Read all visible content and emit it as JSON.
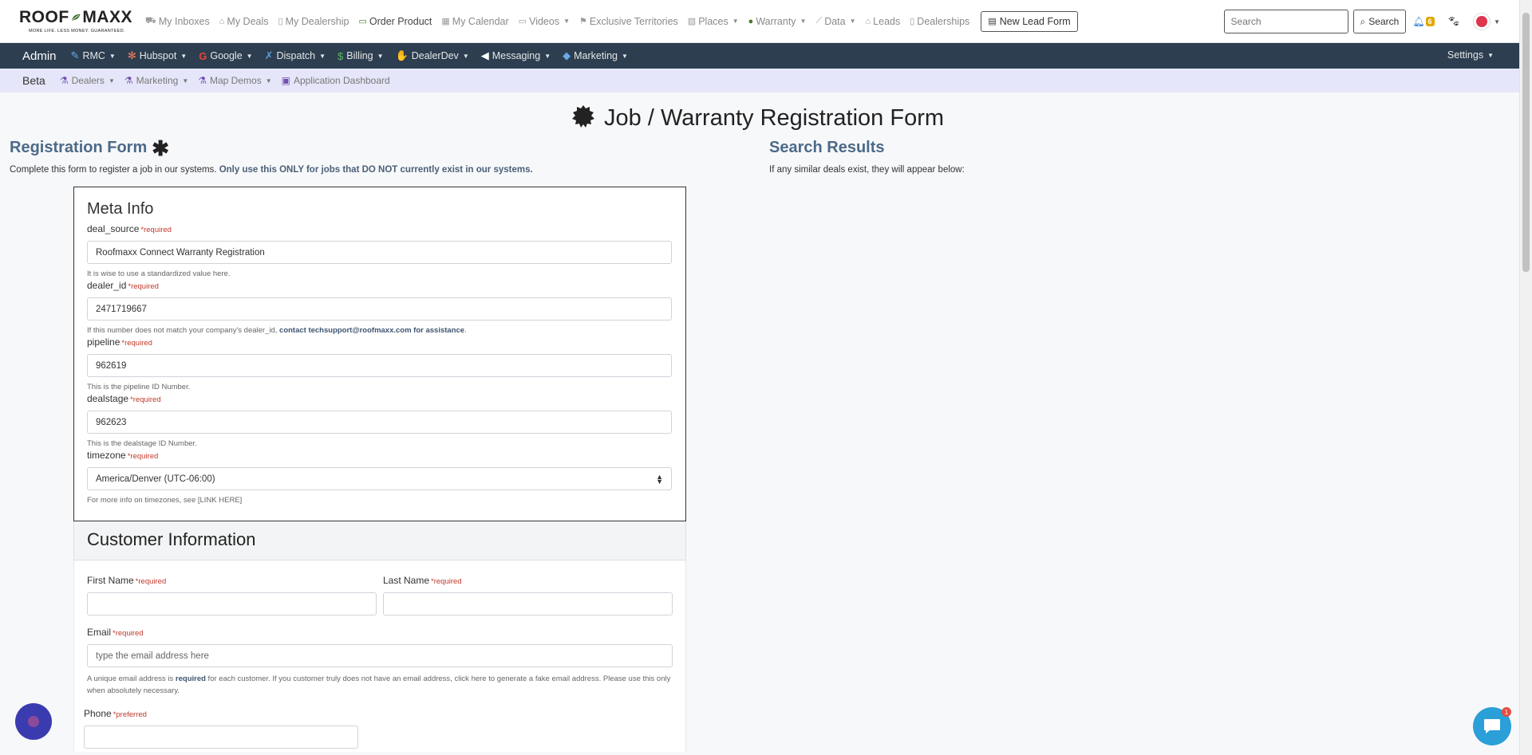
{
  "brand": {
    "name_left": "ROOF",
    "name_right": "MAXX",
    "tagline": "MORE LIFE. LESS MONEY. GUARANTEED."
  },
  "topnav": {
    "items": [
      {
        "label": "My Inboxes",
        "icon": "inbox-icon",
        "glyph": "⛟"
      },
      {
        "label": "My Deals",
        "icon": "home-icon",
        "glyph": "⌂"
      },
      {
        "label": "My Dealership",
        "icon": "building-icon",
        "glyph": "▯"
      },
      {
        "label": "Order Product",
        "icon": "product-icon",
        "glyph": "▭"
      },
      {
        "label": "My Calendar",
        "icon": "calendar-icon",
        "glyph": "▦"
      },
      {
        "label": "Videos",
        "icon": "monitor-icon",
        "glyph": "▭"
      },
      {
        "label": "Exclusive Territories",
        "icon": "flag-icon",
        "glyph": "⚑"
      },
      {
        "label": "Places",
        "icon": "map-icon",
        "glyph": "▧"
      },
      {
        "label": "Warranty",
        "icon": "seal-icon",
        "glyph": "●"
      },
      {
        "label": "Data",
        "icon": "chart-line-icon",
        "glyph": "📈"
      },
      {
        "label": "Leads",
        "icon": "home-icon",
        "glyph": "⌂"
      },
      {
        "label": "Dealerships",
        "icon": "building-icon",
        "glyph": "▯"
      }
    ],
    "new_lead_label": "New Lead Form",
    "search_placeholder": "Search",
    "search_button": "Search",
    "notification_count": "6"
  },
  "adminbar": {
    "title": "Admin",
    "items": [
      {
        "label": "RMC",
        "icon": "feather-icon",
        "glyph": "✎"
      },
      {
        "label": "Hubspot",
        "icon": "hubspot-icon",
        "glyph": "✻"
      },
      {
        "label": "Google",
        "icon": "google-icon",
        "glyph": "G"
      },
      {
        "label": "Dispatch",
        "icon": "wrench-icon",
        "glyph": "✗"
      },
      {
        "label": "Billing",
        "icon": "dollar-icon",
        "glyph": "$"
      },
      {
        "label": "DealerDev",
        "icon": "handshake-icon",
        "glyph": "✋"
      },
      {
        "label": "Messaging",
        "icon": "bullhorn-icon",
        "glyph": "📢"
      },
      {
        "label": "Marketing",
        "icon": "tags-icon",
        "glyph": "🏷"
      }
    ],
    "settings": "Settings"
  },
  "betabar": {
    "title": "Beta",
    "items": [
      {
        "label": "Dealers",
        "icon": "flask-icon",
        "caret": true
      },
      {
        "label": "Marketing",
        "icon": "flask-icon",
        "caret": true
      },
      {
        "label": "Map Demos",
        "icon": "flask-icon",
        "caret": true
      },
      {
        "label": "Application Dashboard",
        "icon": "dashboard-icon",
        "caret": false
      }
    ]
  },
  "page": {
    "title": "Job / Warranty Registration Form"
  },
  "registration": {
    "heading": "Registration Form",
    "desc_plain": "Complete this form to register a job in our systems. ",
    "desc_bold": "Only use this ONLY for jobs that DO NOT currently exist in our systems."
  },
  "search_results": {
    "heading": "Search Results",
    "desc": "If any similar deals exist, they will appear below:"
  },
  "meta": {
    "heading": "Meta Info",
    "required_text": "*required",
    "fields": {
      "deal_source": {
        "label": "deal_source",
        "value": "Roofmaxx Connect Warranty Registration",
        "help": "It is wise to use a standardized value here."
      },
      "dealer_id": {
        "label": "dealer_id",
        "value": "2471719667",
        "help_plain": "If this number does not match your company's dealer_id, ",
        "help_bold": "contact techsupport@roofmaxx.com for assistance",
        "help_end": "."
      },
      "pipeline": {
        "label": "pipeline",
        "value": "962619",
        "help": "This is the pipeline ID Number."
      },
      "dealstage": {
        "label": "dealstage",
        "value": "962623",
        "help": "This is the dealstage ID Number."
      },
      "timezone": {
        "label": "timezone",
        "value": "America/Denver (UTC-06:00)",
        "help": "For more info on timezones, see [LINK HERE]"
      }
    }
  },
  "customer": {
    "heading": "Customer Information",
    "first_name_label": "First Name",
    "last_name_label": "Last Name",
    "email_label": "Email",
    "email_placeholder": "type the email address here",
    "email_help_a": "A unique email address is ",
    "email_help_bold": "required",
    "email_help_b": " for each customer. If you customer truly does not have an email address, click here to generate a fake email address. Please use this only when absolutely necessary.",
    "phone_label": "Phone",
    "preferred_text": "*preferred"
  },
  "chat": {
    "unread": "1"
  },
  "colors": {
    "adminbar": "#2c3e50",
    "betabar": "#e6e6fa",
    "heading_blue": "#4c6a88",
    "required_red": "#c0392b"
  }
}
